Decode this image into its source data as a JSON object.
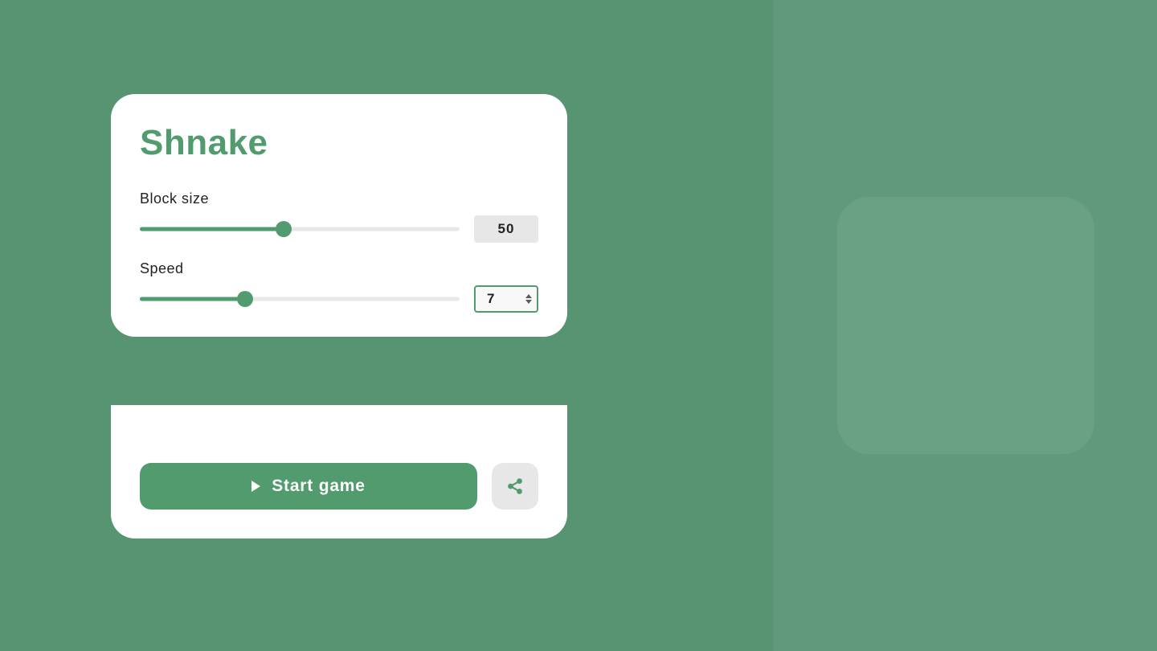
{
  "title": "Shnake",
  "controls": {
    "block_size": {
      "label": "Block size",
      "value": 50,
      "percent": 45
    },
    "speed": {
      "label": "Speed",
      "value": 7,
      "percent": 33
    }
  },
  "actions": {
    "start_label": "Start game"
  },
  "colors": {
    "accent": "#519b6e"
  }
}
